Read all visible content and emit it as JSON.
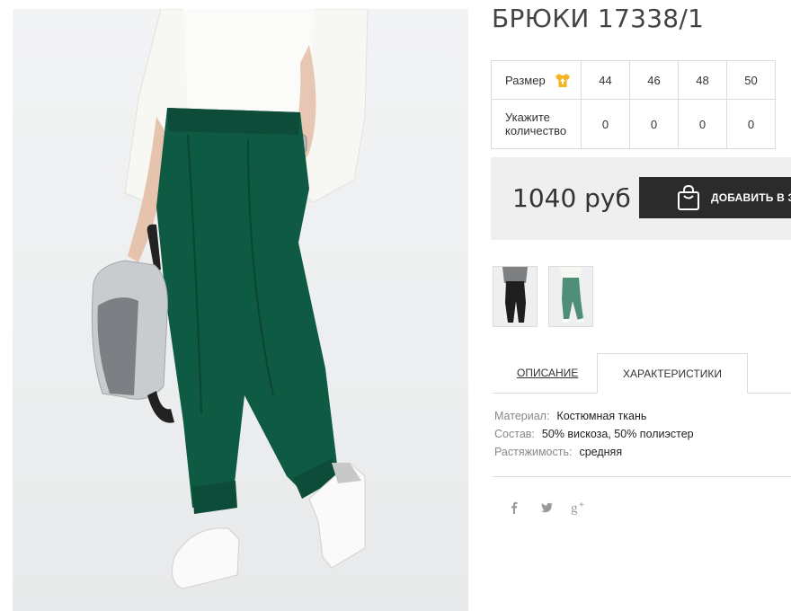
{
  "product": {
    "title": "БРЮКИ 17338/1"
  },
  "sizes": {
    "size_label": "Размер",
    "size_icon": "tshirt-arrow-icon",
    "quantity_label_line1": "Укажите",
    "quantity_label_line2": "количество",
    "columns": [
      {
        "size": "44",
        "qty": "0"
      },
      {
        "size": "46",
        "qty": "0"
      },
      {
        "size": "48",
        "qty": "0"
      },
      {
        "size": "50",
        "qty": "0"
      }
    ]
  },
  "price": {
    "value": "1040 руб"
  },
  "cart": {
    "add_label": "ДОБАВИТЬ В З",
    "icon": "shopping-bag-icon"
  },
  "thumbnails": [
    {
      "alt": "black-pants-thumbnail"
    },
    {
      "alt": "green-pants-thumbnail"
    }
  ],
  "tabs": {
    "description": "ОПИСАНИЕ",
    "characteristics": "ХАРАКТЕРИСТИКИ",
    "active": "characteristics"
  },
  "specs": [
    {
      "label": "Материал:",
      "value": "Костюмная ткань"
    },
    {
      "label": "Состав:",
      "value": "50% вискоза, 50% полиэстер"
    },
    {
      "label": "Растяжимость:",
      "value": "средняя"
    }
  ],
  "social": {
    "facebook": "f",
    "twitter": "twitter-icon",
    "gplus": "g+"
  },
  "colors": {
    "accent_icon": "#f5b41e",
    "button_bg": "#2b2b2b",
    "pants_green": "#0f5a43"
  }
}
